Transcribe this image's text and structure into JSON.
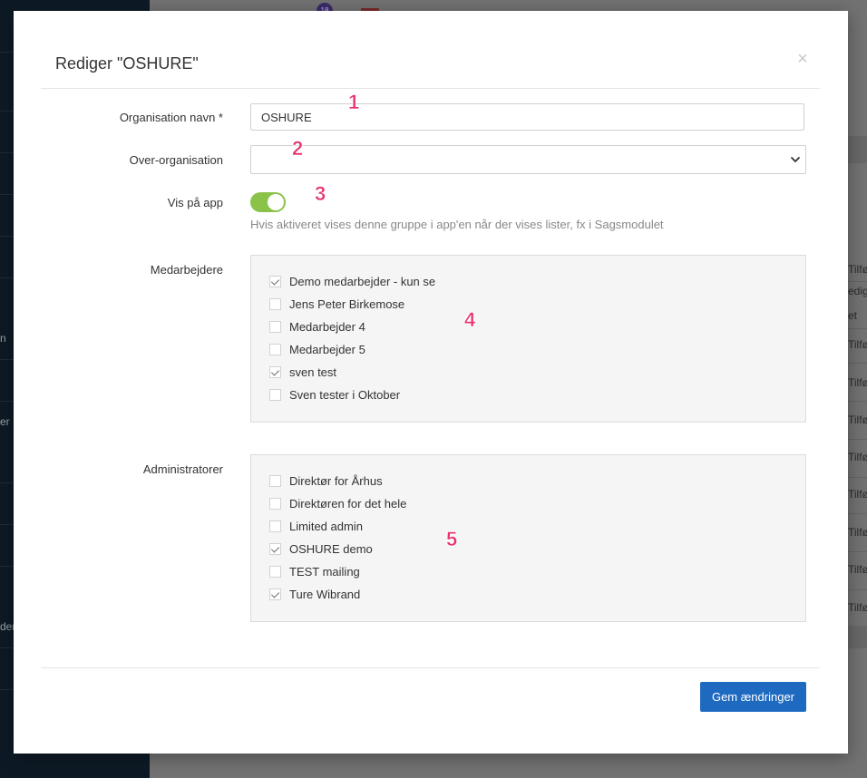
{
  "background": {
    "badge_count": "18",
    "sidebar_fragments": [
      "n",
      "er",
      "der"
    ],
    "table_fragments": [
      "Tilføj",
      "edige",
      "et",
      "Tilføj",
      "Tilføj",
      "Tilføj",
      "Tilføj",
      "Tilføj",
      "Tilføj",
      "Tilføj",
      "Tilføj",
      "Tilføj"
    ]
  },
  "modal": {
    "title": "Rediger \"OSHURE\"",
    "close_glyph": "×",
    "fields": {
      "org_name_label": "Organisation navn *",
      "org_name_value": "OSHURE",
      "parent_org_label": "Over-organisation",
      "parent_org_value": "",
      "show_in_app_label": "Vis på app",
      "show_in_app_on": true,
      "show_in_app_help": "Hvis aktiveret vises denne gruppe i app'en når der vises lister, fx i Sagsmodulet"
    },
    "employees": {
      "label": "Medarbejdere",
      "items": [
        {
          "label": "Demo medarbejder - kun se",
          "checked": true
        },
        {
          "label": "Jens Peter Birkemose",
          "checked": false
        },
        {
          "label": "Medarbejder 4",
          "checked": false
        },
        {
          "label": "Medarbejder 5",
          "checked": false
        },
        {
          "label": "sven test",
          "checked": true
        },
        {
          "label": "Sven tester i Oktober",
          "checked": false
        }
      ]
    },
    "admins": {
      "label": "Administratorer",
      "items": [
        {
          "label": "Direktør for Århus",
          "checked": false
        },
        {
          "label": "Direktøren for det hele",
          "checked": false
        },
        {
          "label": "Limited admin",
          "checked": false
        },
        {
          "label": "OSHURE demo",
          "checked": true
        },
        {
          "label": "TEST mailing",
          "checked": false
        },
        {
          "label": "Ture Wibrand",
          "checked": true
        }
      ]
    },
    "save_label": "Gem ændringer"
  },
  "annotations": [
    "1",
    "2",
    "3",
    "4",
    "5"
  ],
  "colors": {
    "primary": "#1f6ac1",
    "toggle_on": "#8bc34a",
    "annotation": "#e8326e",
    "sidebar": "#0d1a25"
  }
}
